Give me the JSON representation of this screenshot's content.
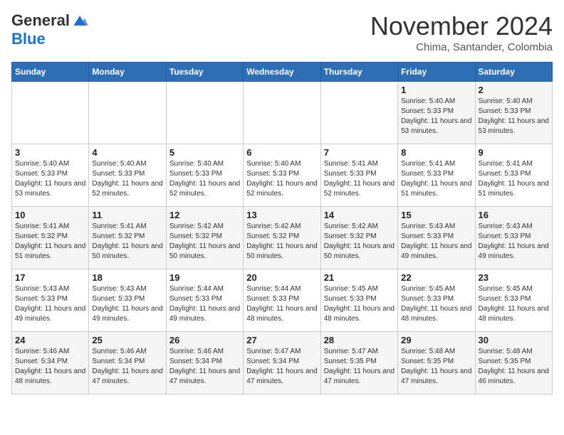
{
  "logo": {
    "general": "General",
    "blue": "Blue"
  },
  "header": {
    "month": "November 2024",
    "location": "Chima, Santander, Colombia"
  },
  "weekdays": [
    "Sunday",
    "Monday",
    "Tuesday",
    "Wednesday",
    "Thursday",
    "Friday",
    "Saturday"
  ],
  "weeks": [
    [
      {
        "day": "",
        "info": ""
      },
      {
        "day": "",
        "info": ""
      },
      {
        "day": "",
        "info": ""
      },
      {
        "day": "",
        "info": ""
      },
      {
        "day": "",
        "info": ""
      },
      {
        "day": "1",
        "info": "Sunrise: 5:40 AM\nSunset: 5:33 PM\nDaylight: 11 hours and 53 minutes."
      },
      {
        "day": "2",
        "info": "Sunrise: 5:40 AM\nSunset: 5:33 PM\nDaylight: 11 hours and 53 minutes."
      }
    ],
    [
      {
        "day": "3",
        "info": "Sunrise: 5:40 AM\nSunset: 5:33 PM\nDaylight: 11 hours and 53 minutes."
      },
      {
        "day": "4",
        "info": "Sunrise: 5:40 AM\nSunset: 5:33 PM\nDaylight: 11 hours and 52 minutes."
      },
      {
        "day": "5",
        "info": "Sunrise: 5:40 AM\nSunset: 5:33 PM\nDaylight: 11 hours and 52 minutes."
      },
      {
        "day": "6",
        "info": "Sunrise: 5:40 AM\nSunset: 5:33 PM\nDaylight: 11 hours and 52 minutes."
      },
      {
        "day": "7",
        "info": "Sunrise: 5:41 AM\nSunset: 5:33 PM\nDaylight: 11 hours and 52 minutes."
      },
      {
        "day": "8",
        "info": "Sunrise: 5:41 AM\nSunset: 5:33 PM\nDaylight: 11 hours and 51 minutes."
      },
      {
        "day": "9",
        "info": "Sunrise: 5:41 AM\nSunset: 5:33 PM\nDaylight: 11 hours and 51 minutes."
      }
    ],
    [
      {
        "day": "10",
        "info": "Sunrise: 5:41 AM\nSunset: 5:32 PM\nDaylight: 11 hours and 51 minutes."
      },
      {
        "day": "11",
        "info": "Sunrise: 5:41 AM\nSunset: 5:32 PM\nDaylight: 11 hours and 50 minutes."
      },
      {
        "day": "12",
        "info": "Sunrise: 5:42 AM\nSunset: 5:32 PM\nDaylight: 11 hours and 50 minutes."
      },
      {
        "day": "13",
        "info": "Sunrise: 5:42 AM\nSunset: 5:32 PM\nDaylight: 11 hours and 50 minutes."
      },
      {
        "day": "14",
        "info": "Sunrise: 5:42 AM\nSunset: 5:32 PM\nDaylight: 11 hours and 50 minutes."
      },
      {
        "day": "15",
        "info": "Sunrise: 5:43 AM\nSunset: 5:33 PM\nDaylight: 11 hours and 49 minutes."
      },
      {
        "day": "16",
        "info": "Sunrise: 5:43 AM\nSunset: 5:33 PM\nDaylight: 11 hours and 49 minutes."
      }
    ],
    [
      {
        "day": "17",
        "info": "Sunrise: 5:43 AM\nSunset: 5:33 PM\nDaylight: 11 hours and 49 minutes."
      },
      {
        "day": "18",
        "info": "Sunrise: 5:43 AM\nSunset: 5:33 PM\nDaylight: 11 hours and 49 minutes."
      },
      {
        "day": "19",
        "info": "Sunrise: 5:44 AM\nSunset: 5:33 PM\nDaylight: 11 hours and 49 minutes."
      },
      {
        "day": "20",
        "info": "Sunrise: 5:44 AM\nSunset: 5:33 PM\nDaylight: 11 hours and 48 minutes."
      },
      {
        "day": "21",
        "info": "Sunrise: 5:45 AM\nSunset: 5:33 PM\nDaylight: 11 hours and 48 minutes."
      },
      {
        "day": "22",
        "info": "Sunrise: 5:45 AM\nSunset: 5:33 PM\nDaylight: 11 hours and 48 minutes."
      },
      {
        "day": "23",
        "info": "Sunrise: 5:45 AM\nSunset: 5:33 PM\nDaylight: 11 hours and 48 minutes."
      }
    ],
    [
      {
        "day": "24",
        "info": "Sunrise: 5:46 AM\nSunset: 5:34 PM\nDaylight: 11 hours and 48 minutes."
      },
      {
        "day": "25",
        "info": "Sunrise: 5:46 AM\nSunset: 5:34 PM\nDaylight: 11 hours and 47 minutes."
      },
      {
        "day": "26",
        "info": "Sunrise: 5:46 AM\nSunset: 5:34 PM\nDaylight: 11 hours and 47 minutes."
      },
      {
        "day": "27",
        "info": "Sunrise: 5:47 AM\nSunset: 5:34 PM\nDaylight: 11 hours and 47 minutes."
      },
      {
        "day": "28",
        "info": "Sunrise: 5:47 AM\nSunset: 5:35 PM\nDaylight: 11 hours and 47 minutes."
      },
      {
        "day": "29",
        "info": "Sunrise: 5:48 AM\nSunset: 5:35 PM\nDaylight: 11 hours and 47 minutes."
      },
      {
        "day": "30",
        "info": "Sunrise: 5:48 AM\nSunset: 5:35 PM\nDaylight: 11 hours and 46 minutes."
      }
    ]
  ]
}
